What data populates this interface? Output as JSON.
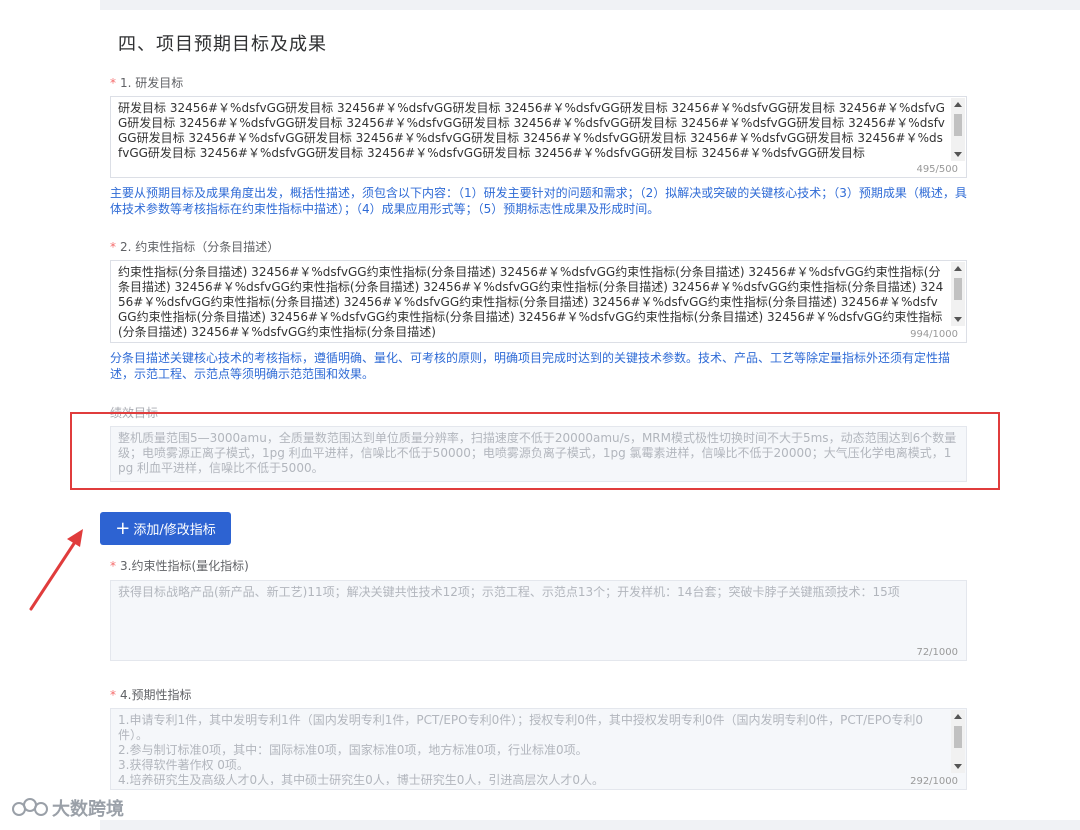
{
  "section": {
    "title": "四、项目预期目标及成果"
  },
  "research_goal": {
    "label": "1. 研发目标",
    "text": "研发目标 32456#￥%dsfvGG研发目标 32456#￥%dsfvGG研发目标 32456#￥%dsfvGG研发目标 32456#￥%dsfvGG研发目标 32456#￥%dsfvGG研发目标 32456#￥%dsfvGG研发目标 32456#￥%dsfvGG研发目标 32456#￥%dsfvGG研发目标 32456#￥%dsfvGG研发目标 32456#￥%dsfvGG研发目标 32456#￥%dsfvGG研发目标 32456#￥%dsfvGG研发目标 32456#￥%dsfvGG研发目标 32456#￥%dsfvGG研发目标 32456#￥%dsfvGG研发目标 32456#￥%dsfvGG研发目标 32456#￥%dsfvGG研发目标 32456#￥%dsfvGG研发目标 32456#￥%dsfvGG研发目标",
    "counter": "495/500",
    "hint": "主要从预期目标及成果角度出发，概括性描述，须包含以下内容：（1）研发主要针对的问题和需求；（2）拟解决或突破的关键核心技术；（3）预期成果（概述，具体技术参数等考核指标在约束性指标中描述）；（4）成果应用形式等；（5）预期标志性成果及形成时间。"
  },
  "constraint_items": {
    "label": "2. 约束性指标（分条目描述）",
    "text": "约束性指标(分条目描述) 32456#￥%dsfvGG约束性指标(分条目描述) 32456#￥%dsfvGG约束性指标(分条目描述) 32456#￥%dsfvGG约束性指标(分条目描述) 32456#￥%dsfvGG约束性指标(分条目描述) 32456#￥%dsfvGG约束性指标(分条目描述) 32456#￥%dsfvGG约束性指标(分条目描述) 32456#￥%dsfvGG约束性指标(分条目描述) 32456#￥%dsfvGG约束性指标(分条目描述) 32456#￥%dsfvGG约束性指标(分条目描述) 32456#￥%dsfvGG约束性指标(分条目描述) 32456#￥%dsfvGG约束性指标(分条目描述) 32456#￥%dsfvGG约束性指标(分条目描述) 32456#￥%dsfvGG约束性指标(分条目描述) 32456#￥%dsfvGG约束性指标(分条目描述)",
    "counter": "994/1000",
    "hint": "分条目描述关键核心技术的考核指标，遵循明确、量化、可考核的原则，明确项目完成时达到的关键技术参数。技术、产品、工艺等除定量指标外还须有定性描述，示范工程、示范点等须明确示范范围和效果。"
  },
  "performance_goal": {
    "label": "绩效目标",
    "text": "整机质量范围5—3000amu，全质量数范围达到单位质量分辨率，扫描速度不低于20000amu/s，MRM模式极性切换时间不大于5ms，动态范围达到6个数量级；电喷雾源正离子模式，1pg 利血平进样，信噪比不低于50000；电喷雾源负离子模式，1pg 氯霉素进样，信噪比不低于20000；大气压化学电离模式，1pg 利血平进样，信噪比不低于5000。"
  },
  "add_button": {
    "label": "添加/修改指标"
  },
  "quantified": {
    "label": "3.约束性指标(量化指标)",
    "text": "获得目标战略产品(新产品、新工艺)11项；解决关键共性技术12项；示范工程、示范点13个；开发样机：14台套；突破卡脖子关键瓶颈技术：15项",
    "counter": "72/1000"
  },
  "expected": {
    "label": "4.预期性指标",
    "lines": [
      "1.申请专利1件，其中发明专利1件（国内发明专利1件，PCT/EPO专利0件）；授权专利0件，其中授权发明专利0件（国内发明专利0件，PCT/EPO专利0件）。",
      "2.参与制订标准0项，其中：国际标准0项，国家标准0项，地方标准0项，行业标准0项。",
      "3.获得软件著作权 0项。",
      "4.培养研究生及高级人才0人，其中硕士研究生0人，博士研究生0人，引进高层次人才0人。"
    ],
    "counter": "292/1000"
  },
  "watermark": {
    "text": "大数跨境"
  },
  "colors": {
    "primary": "#2d63d2",
    "required": "#f56c6c",
    "hint": "#2f6bd6",
    "annotation_red": "#e03c3c"
  }
}
